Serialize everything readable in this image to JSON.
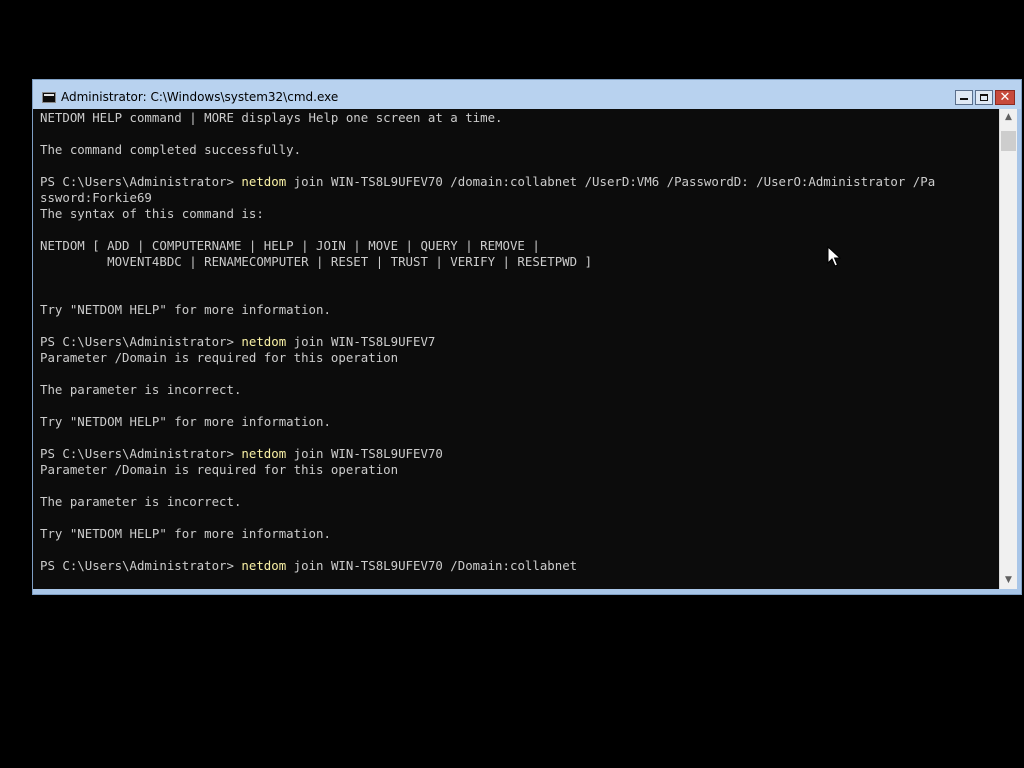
{
  "window": {
    "title": "Administrator: C:\\Windows\\system32\\cmd.exe",
    "icon": "cmd-console-icon",
    "controls": {
      "minimize_icon": "minimize-icon",
      "maximize_icon": "maximize-icon",
      "close_icon": "close-icon",
      "close_glyph": "✕"
    }
  },
  "console": {
    "colors": {
      "background": "#0c0c0c",
      "text": "#cccccc",
      "command": "#f9f1a5"
    },
    "lines": [
      {
        "text": "NETDOM HELP command | MORE displays Help one screen at a time."
      },
      {
        "text": ""
      },
      {
        "text": "The command completed successfully."
      },
      {
        "text": ""
      },
      {
        "prompt": "PS C:\\Users\\Administrator> ",
        "cmd": "netdom",
        "args": " join WIN-TS8L9UFEV70 /domain:collabnet /UserD:VM6 /PasswordD: /UserO:Administrator /Pa"
      },
      {
        "text": "ssword:Forkie69"
      },
      {
        "text": "The syntax of this command is:"
      },
      {
        "text": ""
      },
      {
        "text": "NETDOM [ ADD | COMPUTERNAME | HELP | JOIN | MOVE | QUERY | REMOVE |"
      },
      {
        "text": "         MOVENT4BDC | RENAMECOMPUTER | RESET | TRUST | VERIFY | RESETPWD ]"
      },
      {
        "text": ""
      },
      {
        "text": ""
      },
      {
        "text": "Try \"NETDOM HELP\" for more information."
      },
      {
        "text": ""
      },
      {
        "prompt": "PS C:\\Users\\Administrator> ",
        "cmd": "netdom",
        "args": " join WIN-TS8L9UFEV7"
      },
      {
        "text": "Parameter /Domain is required for this operation"
      },
      {
        "text": ""
      },
      {
        "text": "The parameter is incorrect."
      },
      {
        "text": ""
      },
      {
        "text": "Try \"NETDOM HELP\" for more information."
      },
      {
        "text": ""
      },
      {
        "prompt": "PS C:\\Users\\Administrator> ",
        "cmd": "netdom",
        "args": " join WIN-TS8L9UFEV70"
      },
      {
        "text": "Parameter /Domain is required for this operation"
      },
      {
        "text": ""
      },
      {
        "text": "The parameter is incorrect."
      },
      {
        "text": ""
      },
      {
        "text": "Try \"NETDOM HELP\" for more information."
      },
      {
        "text": ""
      },
      {
        "prompt": "PS C:\\Users\\Administrator> ",
        "cmd": "netdom",
        "args": " join WIN-TS8L9UFEV70 /Domain:collabnet"
      }
    ]
  },
  "scrollbar": {
    "up_glyph": "▲",
    "down_glyph": "▼"
  }
}
